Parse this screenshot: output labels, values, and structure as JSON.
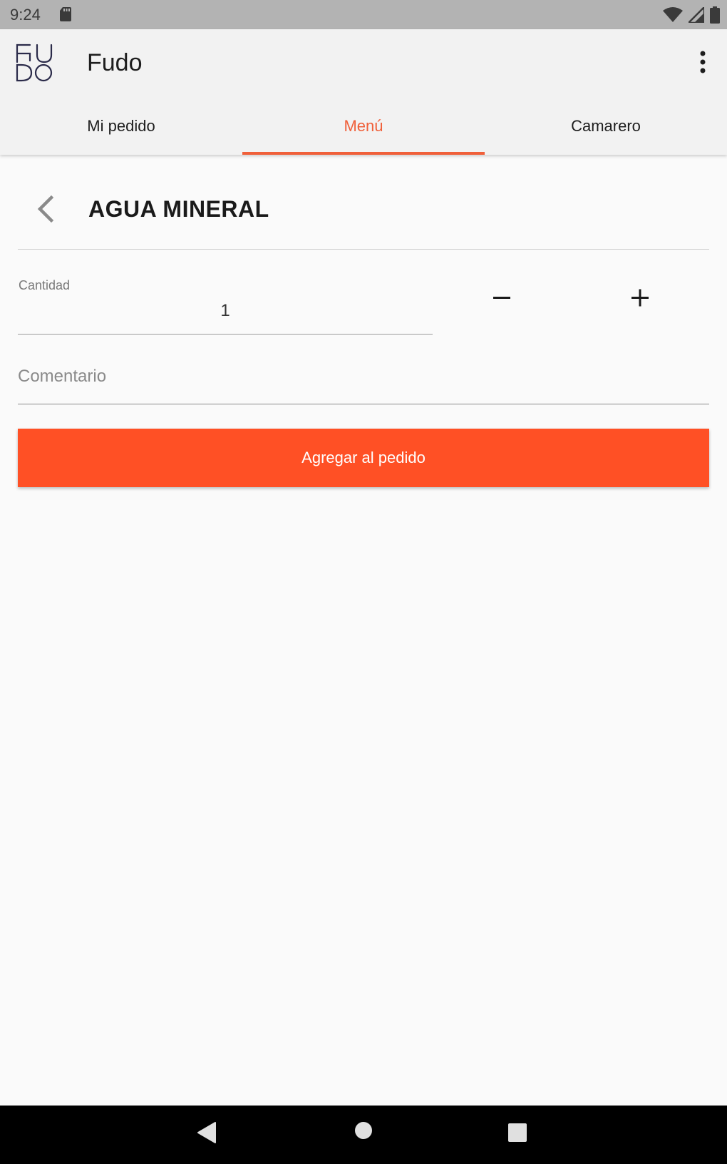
{
  "status_bar": {
    "time": "9:24",
    "icons": [
      "sd-card-icon",
      "wifi-icon",
      "signal-icon",
      "battery-icon"
    ]
  },
  "app_bar": {
    "logo_text": "FUDO",
    "title": "Fudo",
    "overflow_icon": "more-vert-icon"
  },
  "tabs": [
    {
      "label": "Mi pedido",
      "active": false
    },
    {
      "label": "Menú",
      "active": true
    },
    {
      "label": "Camarero",
      "active": false
    }
  ],
  "item": {
    "back_icon": "chevron-left-icon",
    "title": "AGUA MINERAL"
  },
  "quantity": {
    "label": "Cantidad",
    "value": "1",
    "decrement_icon": "minus-icon",
    "increment_icon": "plus-icon"
  },
  "comment": {
    "placeholder": "Comentario",
    "value": ""
  },
  "actions": {
    "add_label": "Agregar al pedido"
  },
  "colors": {
    "accent": "#f0603a",
    "button": "#ff5025",
    "app_bar_bg": "#f2f2f2",
    "page_bg": "#fafafa"
  },
  "nav_bar": {
    "icons": [
      "nav-back-icon",
      "nav-home-icon",
      "nav-recents-icon"
    ]
  }
}
